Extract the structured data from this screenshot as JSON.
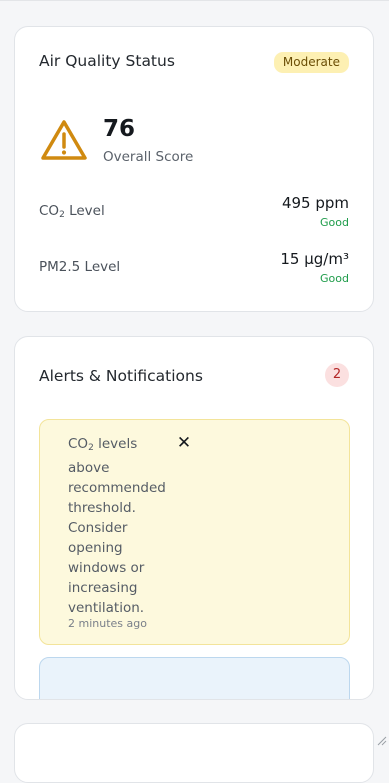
{
  "air_quality": {
    "title": "Air Quality Status",
    "status_badge": "Moderate",
    "icon": "warning-triangle-icon",
    "score": "76",
    "score_label": "Overall Score",
    "metrics": [
      {
        "name_main": "CO",
        "name_sub": "2",
        "name_tail": " Level",
        "value": "495 ppm",
        "status": "Good"
      },
      {
        "name_main": "PM2.5 Level",
        "name_sub": "",
        "name_tail": "",
        "value": "15 μg/m³",
        "status": "Good"
      }
    ]
  },
  "alerts": {
    "title": "Alerts & Notifications",
    "count": "2",
    "items": [
      {
        "text_main": "CO",
        "text_sub": "2",
        "text_tail": " levels above recommended threshold. Consider opening windows or increasing ventilation.",
        "time": "2 minutes ago",
        "close_icon": "close-icon"
      }
    ]
  },
  "colors": {
    "warning": "#d08a10",
    "good": "#1e9c4a",
    "moderate_bg": "#fdf0b3",
    "alert_count_bg": "#fbe0e0"
  }
}
